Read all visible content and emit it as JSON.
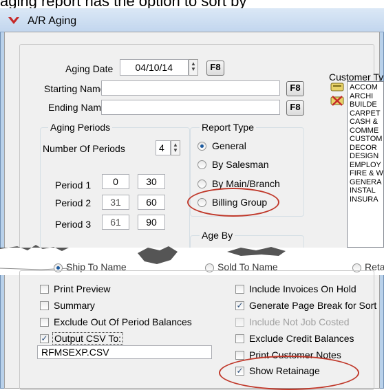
{
  "header": {
    "caption_fragment": "aging report has the option to sort by"
  },
  "window": {
    "title": "A/R Aging",
    "app_icon": "red-chevron-logo-icon"
  },
  "aging_date": {
    "label": "Aging Date",
    "value": "04/10/14",
    "f8": "F8"
  },
  "starting_name": {
    "label": "Starting Name",
    "value": "",
    "f8": "F8"
  },
  "ending_name": {
    "label": "Ending Name",
    "value": "",
    "f8": "F8"
  },
  "aging_periods": {
    "title": "Aging Periods",
    "number_label": "Number Of  Periods",
    "number_value": "4",
    "periods": [
      {
        "label": "Period 1",
        "from": "0",
        "to": "30"
      },
      {
        "label": "Period 2",
        "from": "31",
        "to": "60"
      },
      {
        "label": "Period 3",
        "from": "61",
        "to": "90"
      }
    ]
  },
  "report_type": {
    "title": "Report Type",
    "options": [
      "General",
      "By Salesman",
      "By Main/Branch",
      "Billing Group"
    ],
    "selected": "General"
  },
  "age_by": {
    "title": "Age By"
  },
  "partial_row": {
    "ship_to": "Ship To Name",
    "sold_to": "Sold To Name",
    "retainage": "Retainage"
  },
  "customer_types": {
    "title": "Customer Ty",
    "items": [
      "ACCOM",
      "ARCHI",
      "BUILDE",
      "CARPET",
      "CASH &",
      "COMME",
      "CUSTOM",
      "DECOR",
      "DESIGN",
      "EMPLOY",
      "FIRE & W",
      "GENERA",
      "INSTAL",
      "INSURA"
    ]
  },
  "options_left": [
    {
      "label": "Print Preview",
      "checked": false
    },
    {
      "label": "Summary",
      "checked": false
    },
    {
      "label": "Exclude Out Of Period Balances",
      "checked": false
    },
    {
      "label": "Output CSV To:",
      "checked": true
    }
  ],
  "csv_filename": "RFMSEXP.CSV",
  "options_right": [
    {
      "label": "Include Invoices On Hold",
      "checked": false,
      "disabled": false
    },
    {
      "label": "Generate Page Break for Sort",
      "checked": true,
      "disabled": false
    },
    {
      "label": "Include Not Job Costed",
      "checked": false,
      "disabled": true
    },
    {
      "label": "Exclude Credit Balances",
      "checked": false,
      "disabled": false
    },
    {
      "label": "Print Customer Notes",
      "checked": false,
      "disabled": false
    },
    {
      "label": "Show Retainage",
      "checked": true,
      "disabled": false
    }
  ],
  "colors": {
    "highlight_oval": "#c0392b",
    "window_frame": "#b9d1ea"
  }
}
